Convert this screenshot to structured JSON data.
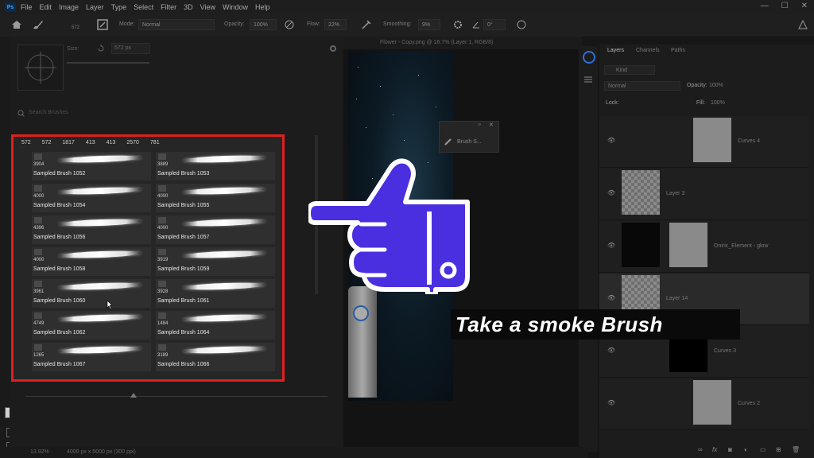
{
  "menubar": {
    "logo": "Ps",
    "items": [
      "File",
      "Edit",
      "Image",
      "Layer",
      "Type",
      "Select",
      "Filter",
      "3D",
      "View",
      "Window",
      "Help"
    ],
    "controls": [
      "—",
      "☐",
      "✕"
    ]
  },
  "options_bar": {
    "mode_label": "Mode:",
    "mode_value": "Normal",
    "opacity_label": "Opacity:",
    "opacity_value": "100%",
    "flow_label": "Flow:",
    "flow_value": "22%",
    "smoothing_label": "Smoothing:",
    "smoothing_value": "9%",
    "angle_value": "0°",
    "brush_size_badge": "572"
  },
  "brush_settings": {
    "size_label": "Size:",
    "size_value": "572 px",
    "search_placeholder": "Search Brushes"
  },
  "document": {
    "tab_title": "Flower - Copy.png @ 16.7% (Layer 1, RGB/8)",
    "status_zoom": "13.92%",
    "status_info": "4000 px x 5000 px (300 ppi)"
  },
  "float_panel": {
    "label": "Brush S..."
  },
  "brush_presets": {
    "sizes": [
      "572",
      "572",
      "1817",
      "413",
      "413",
      "2570",
      "781"
    ],
    "items": [
      {
        "num": "3904",
        "name": "Sampled Brush 1052"
      },
      {
        "num": "3889",
        "name": "Sampled Brush 1053"
      },
      {
        "num": "4000",
        "name": "Sampled Brush 1054"
      },
      {
        "num": "4000",
        "name": "Sampled Brush 1055"
      },
      {
        "num": "4396",
        "name": "Sampled Brush 1056"
      },
      {
        "num": "4000",
        "name": "Sampled Brush 1057"
      },
      {
        "num": "4000",
        "name": "Sampled Brush 1058"
      },
      {
        "num": "3919",
        "name": "Sampled Brush 1059"
      },
      {
        "num": "3961",
        "name": "Sampled Brush 1060"
      },
      {
        "num": "3928",
        "name": "Sampled Brush 1061"
      },
      {
        "num": "4749",
        "name": "Sampled Brush 1062"
      },
      {
        "num": "1484",
        "name": "Sampled Brush 1064"
      },
      {
        "num": "1265",
        "name": "Sampled Brush 1067"
      },
      {
        "num": "3189",
        "name": "Sampled Brush 1066"
      }
    ]
  },
  "layers_panel": {
    "tabs": [
      "Layers",
      "Channels",
      "Paths"
    ],
    "filter_label": "Kind",
    "blend_mode": "Normal",
    "opacity_label": "Opacity:",
    "opacity_value": "100%",
    "lock_label": "Lock:",
    "fill_label": "Fill:",
    "fill_value": "100%",
    "layers": [
      {
        "name": "Curves 4"
      },
      {
        "name": "Layer 3"
      },
      {
        "name": "Oniric_Element - glow"
      },
      {
        "name": "Layer 14"
      },
      {
        "name": "Curves 3"
      },
      {
        "name": "Curves 2"
      }
    ]
  },
  "caption": {
    "text": "Take a smoke Brush"
  },
  "colors": {
    "highlight_border": "#e11f1f",
    "hand_fill": "#4a2fe0",
    "hand_outline": "#ffffff",
    "background": "#161616"
  },
  "icons": [
    "hand-pointing-icon",
    "home-icon",
    "brush-tool-icon",
    "eye-icon"
  ]
}
